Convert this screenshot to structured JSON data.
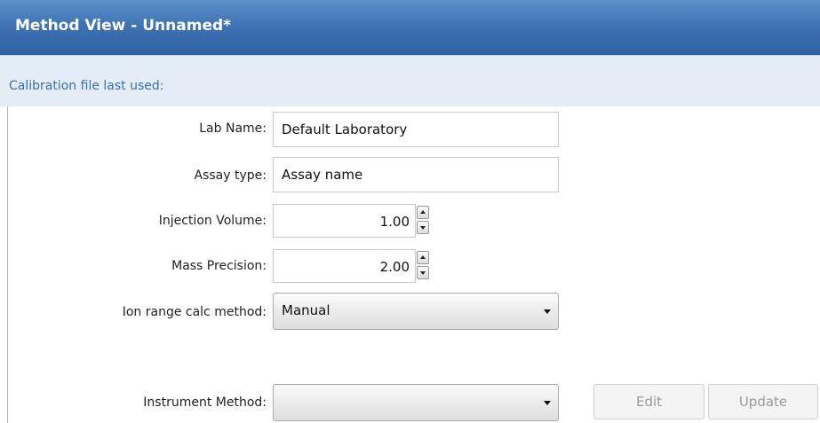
{
  "window": {
    "title": "Method View - Unnamed*"
  },
  "subheader": {
    "text": "Calibration file last used:"
  },
  "form": {
    "lab_name": {
      "label": "Lab Name:",
      "value": "Default Laboratory"
    },
    "assay_type": {
      "label": "Assay type:",
      "value": "Assay name"
    },
    "injection_volume": {
      "label": "Injection Volume:",
      "value": "1.00"
    },
    "mass_precision": {
      "label": "Mass Precision:",
      "value": "2.00"
    },
    "ion_range": {
      "label": "Ion range calc method:",
      "value": "Manual"
    },
    "instrument_method": {
      "label": "Instrument Method:",
      "value": ""
    }
  },
  "buttons": {
    "edit": "Edit",
    "update": "Update"
  },
  "icons": {
    "spin_up": "spin-up-icon",
    "spin_down": "spin-down-icon",
    "dropdown": "chevron-down-icon"
  },
  "colors": {
    "title_bar": "#3a6fb0",
    "subheader_bg": "#e4ecf6",
    "subheader_text": "#3b6fae"
  }
}
